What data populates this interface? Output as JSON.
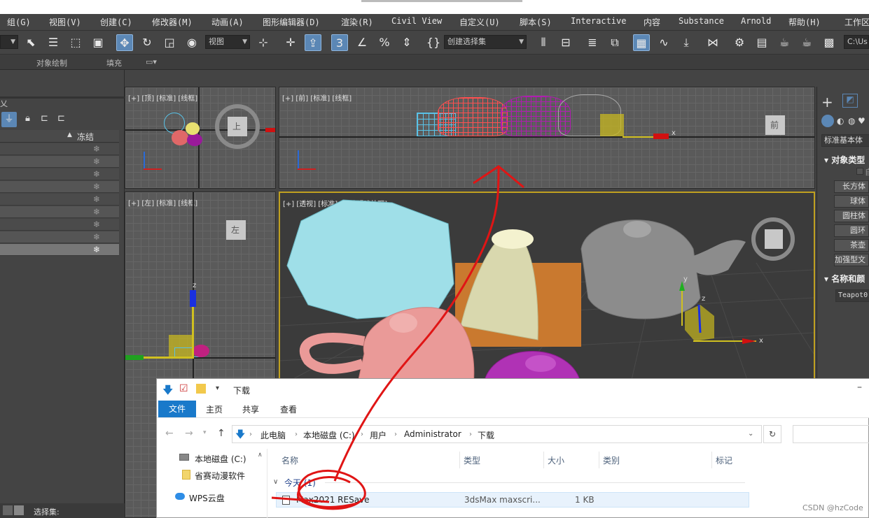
{
  "menubar": {
    "items": [
      "组(G)",
      "视图(V)",
      "创建(C)",
      "修改器(M)",
      "动画(A)",
      "图形编辑器(D)",
      "渲染(R)",
      "Civil View",
      "自定义(U)",
      "脚本(S)",
      "Interactive",
      "内容",
      "Substance",
      "Arnold",
      "帮助(H)",
      "工作区"
    ]
  },
  "toolbar": {
    "view_dropdown": "视图",
    "selection_set_dropdown": "创建选择集",
    "path_field": "C:\\Us"
  },
  "ribbon": {
    "object_paint": "对象绘制",
    "fill": "填充"
  },
  "scene_explorer": {
    "freeze_header": "冻结",
    "freeze_glyph": "❄",
    "bottom_label": "选择集:"
  },
  "viewports": {
    "top": "[+] [顶] [标准] [线框]",
    "front": "[+] [前] [标准] [线框]",
    "left": "[+] [左] [标准] [线框]",
    "perspective": "[+] [透视] [标准] [默认明暗处理]",
    "cube_top": "上",
    "cube_front": "前",
    "cube_left": "左",
    "axis_x": "x",
    "axis_y": "y",
    "axis_z": "z"
  },
  "command_panel": {
    "category": "标准基本体",
    "section_object_type": "对象类型",
    "autogrid": "自",
    "buttons": [
      "长方体",
      "球体",
      "圆柱体",
      "圆环",
      "茶壶",
      "加强型文"
    ],
    "section_name_color": "名称和颜",
    "name_field": "Teapot0"
  },
  "explorer": {
    "title": "下载",
    "tabs": {
      "file": "文件",
      "home": "主页",
      "share": "共享",
      "view": "查看"
    },
    "path": [
      "此电脑",
      "本地磁盘 (C:)",
      "用户",
      "Administrator",
      "下载"
    ],
    "nav_items": [
      "本地磁盘 (C:)",
      "省赛动漫软件",
      "WPS云盘"
    ],
    "columns": {
      "name": "名称",
      "type": "类型",
      "size": "大小",
      "category": "类别",
      "tags": "标记"
    },
    "group_label": "今天 (1)",
    "file": {
      "name": "Max2021 RESave",
      "type": "3dsMax maxscri...",
      "size": "1 KB"
    }
  },
  "watermark": "CSDN @hzCode",
  "colors": {
    "annotation_red": "#e01515",
    "active_blue": "#5b87b5",
    "explorer_blue": "#1979ca",
    "viewport_gold": "#c0a020"
  }
}
